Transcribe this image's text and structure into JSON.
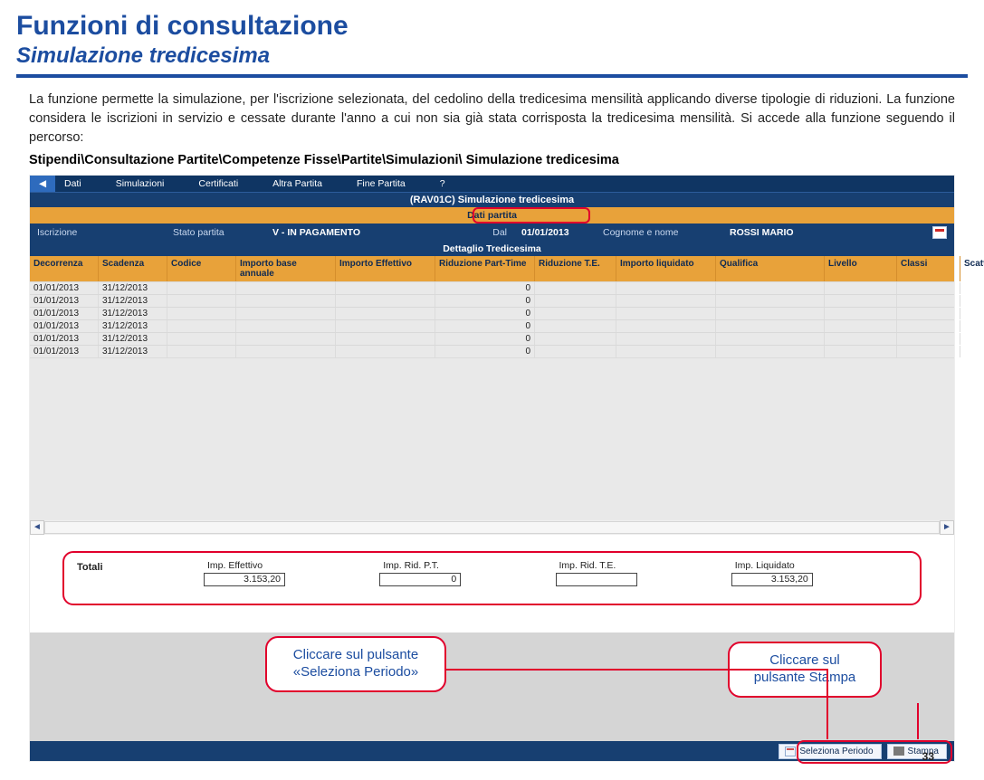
{
  "page": {
    "title": "Funzioni di consultazione",
    "subtitle": "Simulazione tredicesima",
    "intro": "La funzione permette la simulazione, per l'iscrizione selezionata, del cedolino della tredicesima mensilità applicando diverse tipologie di riduzioni. La funzione considera le iscrizioni in servizio e cessate durante l'anno a cui non sia già stata corrisposta la tredicesima mensilità. Si accede alla funzione seguendo il percorso:",
    "path": "Stipendi\\Consultazione Partite\\Competenze Fisse\\Partite\\Simulazioni\\ Simulazione tredicesima",
    "number": "33"
  },
  "menu": {
    "items": [
      "Dati",
      "Simulazioni",
      "Certificati",
      "Altra Partita",
      "Fine Partita",
      "?"
    ]
  },
  "screen": {
    "code_title": "(RAV01C) Simulazione tredicesima",
    "dati_partita": "Dati partita",
    "dettaglio": "Dettaglio Tredicesima"
  },
  "info": {
    "iscrizione_lbl": "Iscrizione",
    "stato_lbl": "Stato partita",
    "stato_val": "V - IN PAGAMENTO",
    "dal_lbl": "Dal",
    "dal_val": "01/01/2013",
    "cognome_lbl": "Cognome e nome",
    "cognome_val": "ROSSI MARIO"
  },
  "cols": [
    "Decorrenza",
    "Scadenza",
    "Codice",
    "Importo base annuale",
    "Importo Effettivo",
    "Riduzione Part-Time",
    "Riduzione T.E.",
    "Importo liquidato",
    "Qualifica",
    "Livello",
    "Classi",
    "Scatti"
  ],
  "rows": [
    {
      "dec": "01/01/2013",
      "scad": "31/12/2013",
      "rid_pt": "0"
    },
    {
      "dec": "01/01/2013",
      "scad": "31/12/2013",
      "rid_pt": "0"
    },
    {
      "dec": "01/01/2013",
      "scad": "31/12/2013",
      "rid_pt": "0"
    },
    {
      "dec": "01/01/2013",
      "scad": "31/12/2013",
      "rid_pt": "0"
    },
    {
      "dec": "01/01/2013",
      "scad": "31/12/2013",
      "rid_pt": "0"
    },
    {
      "dec": "01/01/2013",
      "scad": "31/12/2013",
      "rid_pt": "0"
    }
  ],
  "totali": {
    "label": "Totali",
    "c1_lbl": "Imp. Effettivo",
    "c1_val": "3.153,20",
    "c2_lbl": "Imp. Rid. P.T.",
    "c2_val": "0",
    "c3_lbl": "Imp. Rid. T.E.",
    "c3_val": "",
    "c4_lbl": "Imp. Liquidato",
    "c4_val": "3.153,20"
  },
  "callouts": {
    "left": "Cliccare sul pulsante «Seleziona Periodo»",
    "right": "Cliccare sul pulsante Stampa"
  },
  "footer": {
    "btn1": "Seleziona Periodo",
    "btn2": "Stampa"
  }
}
